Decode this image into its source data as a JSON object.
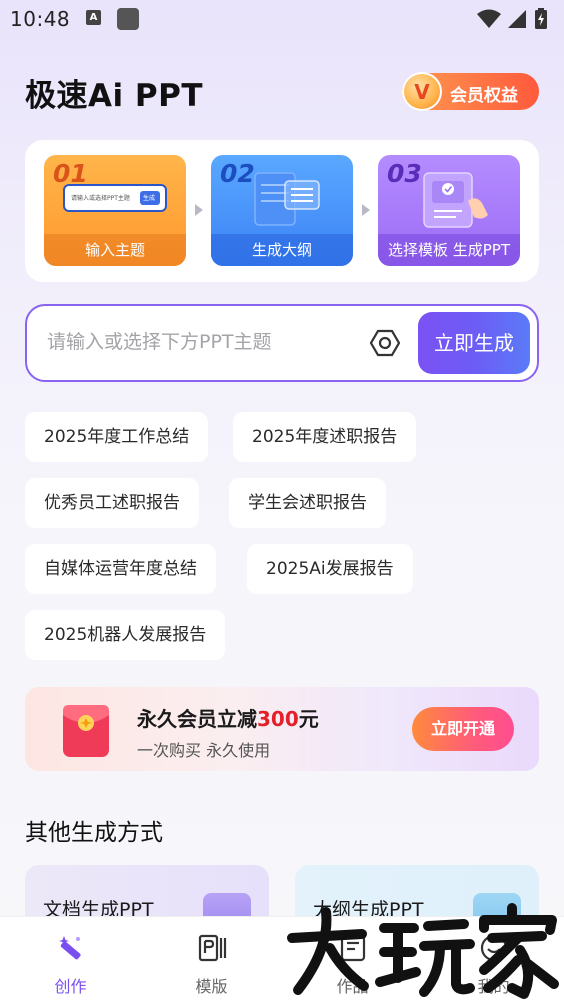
{
  "status_bar": {
    "time": "10:48",
    "indicator_letter": "A"
  },
  "header": {
    "title": "极速Ai PPT",
    "vip_badge_letter": "V",
    "vip_label": "会员权益"
  },
  "steps": [
    {
      "num": "01",
      "label": "输入主题",
      "mini_input": "请输入或选择PPT主题",
      "mini_button": "生成"
    },
    {
      "num": "02",
      "label": "生成大纲"
    },
    {
      "num": "03",
      "label": "选择模板 生成PPT"
    }
  ],
  "input": {
    "placeholder": "请输入或选择下方PPT主题",
    "value": "",
    "generate_label": "立即生成"
  },
  "chips": [
    "2025年度工作总结",
    "2025年度述职报告",
    "优秀员工述职报告",
    "学生会述职报告",
    "自媒体运营年度总结",
    "2025Ai发展报告",
    "2025机器人发展报告"
  ],
  "promo": {
    "title_prefix": "永久会员立减",
    "price": "300",
    "unit": "元",
    "subtitle": "一次购买 永久使用",
    "button": "立即开通"
  },
  "other_methods": {
    "title": "其他生成方式",
    "items": [
      {
        "label": "文档生成PPT"
      },
      {
        "label": "大纲生成PPT"
      }
    ]
  },
  "bottom_nav": [
    {
      "label": "创作",
      "icon": "magic-wand-icon",
      "active": true
    },
    {
      "label": "模版",
      "icon": "template-icon",
      "active": false
    },
    {
      "label": "作品",
      "icon": "works-icon",
      "active": false
    },
    {
      "label": "我的",
      "icon": "profile-icon",
      "active": false
    }
  ],
  "watermark": "大玩家",
  "colors": {
    "accent": "#7b52f4",
    "vip_orange": "#ff5a3c",
    "price_red": "#e4202a"
  }
}
